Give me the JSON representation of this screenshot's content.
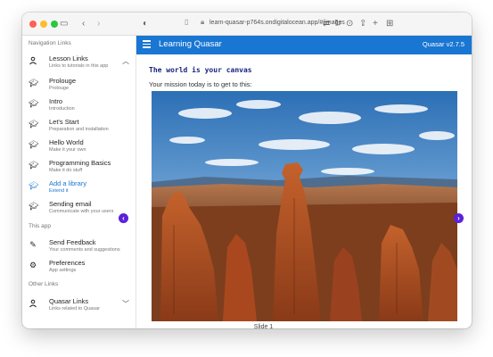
{
  "browser": {
    "url": "learn-quasar-p764s.ondigitalocean.app/#/images"
  },
  "sidebar": {
    "sections": [
      {
        "header": "Navigation Links",
        "items": [
          {
            "icon": "person-icon",
            "label": "Lesson Links",
            "caption": "Links to tutorials in this app",
            "expanded": true
          },
          {
            "icon": "graduation-cap-icon",
            "label": "Prolouge",
            "caption": "Prolouge"
          },
          {
            "icon": "graduation-cap-icon",
            "label": "Intro",
            "caption": "Introduction"
          },
          {
            "icon": "graduation-cap-icon",
            "label": "Let's Start",
            "caption": "Preparation and installation"
          },
          {
            "icon": "graduation-cap-icon",
            "label": "Hello World",
            "caption": "Make it your own"
          },
          {
            "icon": "graduation-cap-icon",
            "label": "Programming Basics",
            "caption": "Make it do stuff"
          },
          {
            "icon": "graduation-cap-icon",
            "label": "Add a library",
            "caption": "Extend it",
            "active": true
          },
          {
            "icon": "graduation-cap-icon",
            "label": "Sending email",
            "caption": "Communicate with your users"
          }
        ]
      },
      {
        "header": "This app",
        "items": [
          {
            "icon": "pencil-icon",
            "label": "Send Feedback",
            "caption": "Your comments and suggestions"
          },
          {
            "icon": "gear-icon",
            "label": "Preferences",
            "caption": "App settings"
          }
        ]
      },
      {
        "header": "Other Links",
        "items": [
          {
            "icon": "person-icon",
            "label": "Quasar Links",
            "caption": "Links related to Quasar",
            "expanded": false
          }
        ]
      }
    ]
  },
  "header": {
    "title": "Learning Quasar",
    "version": "Quasar v2.7.5",
    "color": "#1976d2"
  },
  "main": {
    "title": "The world is your canvas",
    "subtitle": "Your mission today is to get to this:",
    "carousel": {
      "arrow_color": "#5b21d9",
      "slide_caption": "Slide 1"
    }
  }
}
